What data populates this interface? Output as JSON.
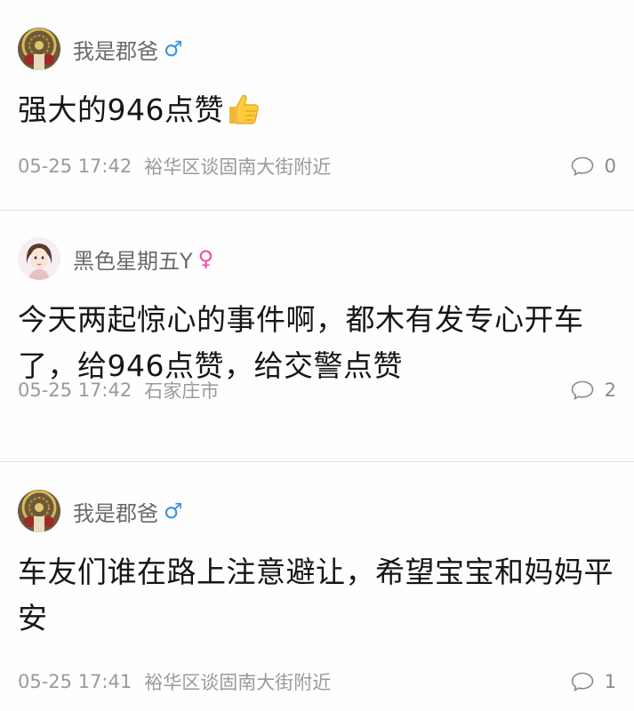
{
  "comments": [
    {
      "username": "我是郡爸",
      "gender": "♂",
      "text": "强大的946点赞",
      "time": "05-25 17:42",
      "location": "裕华区谈固南大街附近",
      "reply_count": "0",
      "emoji_icon": "thumbs-up-icon"
    },
    {
      "username": "黑色星期五Y",
      "gender": "♀",
      "text": "今天两起惊心的事件啊，都木有发专心开车了，给946点赞，给交警点赞",
      "time": "05-25 17:42",
      "location": "石家庄市",
      "reply_count": "2"
    },
    {
      "username": "我是郡爸",
      "gender": "♂",
      "text": "车友们谁在路上注意避让，希望宝宝和妈妈平安",
      "time": "05-25 17:41",
      "location": "裕华区谈固南大街附近",
      "reply_count": "1"
    }
  ],
  "colors": {
    "male": "#3a94e0",
    "female": "#f04aa8",
    "meta_text": "#9a9a9a",
    "divider": "#dedede"
  }
}
